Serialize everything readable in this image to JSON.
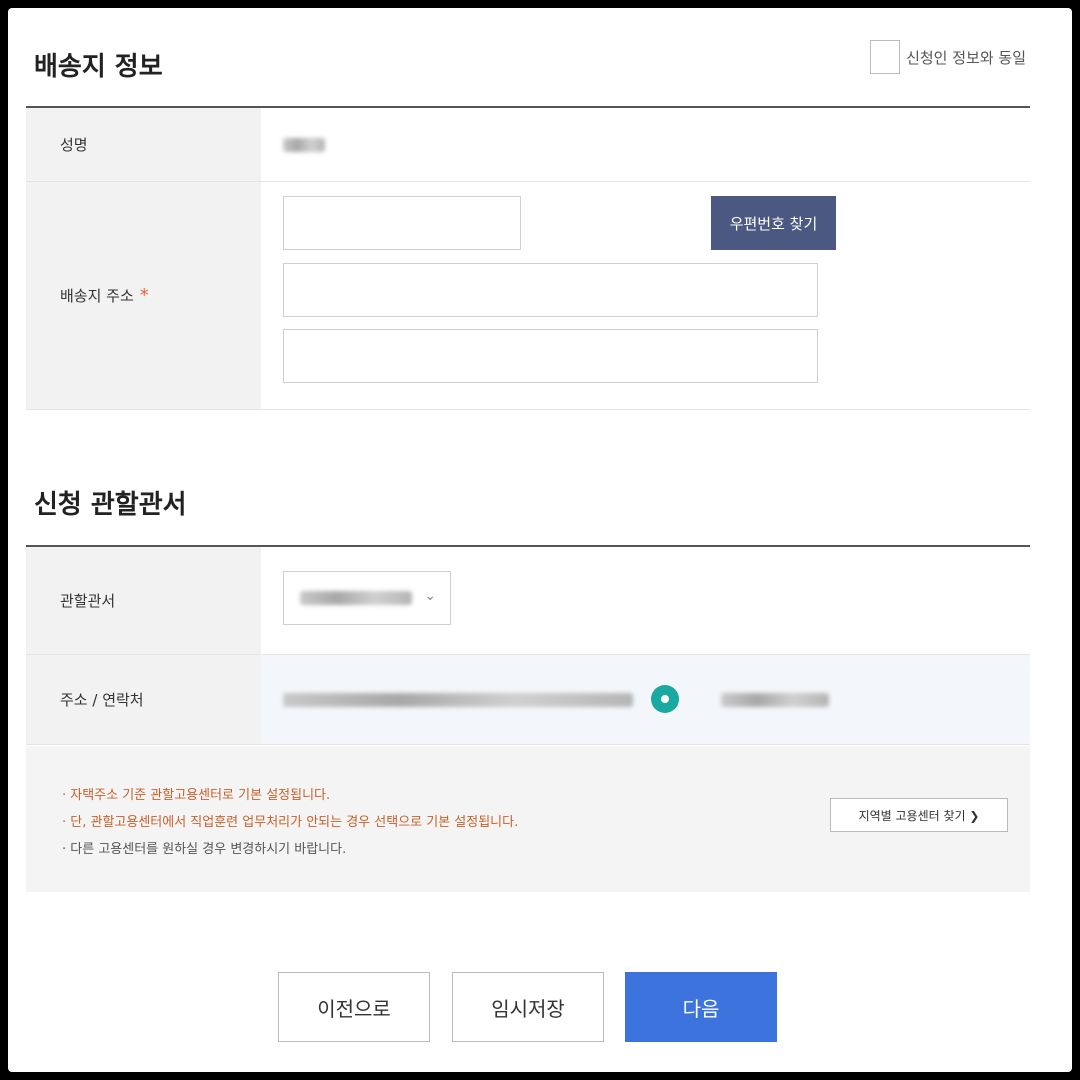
{
  "delivery": {
    "title": "배송지 정보",
    "agree_label": "신청인 정보와 동일",
    "name_label": "성명",
    "address_label": "배송지 주소",
    "required_mark": "*",
    "zip_button": "우편번호 찾기"
  },
  "office": {
    "title": "신청 관할관서",
    "office_label": "관할관서",
    "contact_label": "주소 / 연락처"
  },
  "notice": {
    "lines": [
      "자택주소 기준 관할고용센터로 기본 설정됩니다.",
      "단, 관할고용센터에서 직업훈련 업무처리가 안되는 경우 선택으로 기본 설정됩니다.",
      "다른 고용센터를 원하실 경우 변경하시기 바랍니다."
    ],
    "region_button": "지역별 고용센터 찾기 ❯"
  },
  "buttons": {
    "prev": "이전으로",
    "save": "임시저장",
    "next": "다음"
  },
  "colors": {
    "zip_button_bg": "#4b5882",
    "next_button_bg": "#3d73dc",
    "notice_text": "#c8602a",
    "pin": "#1aa9a0"
  }
}
